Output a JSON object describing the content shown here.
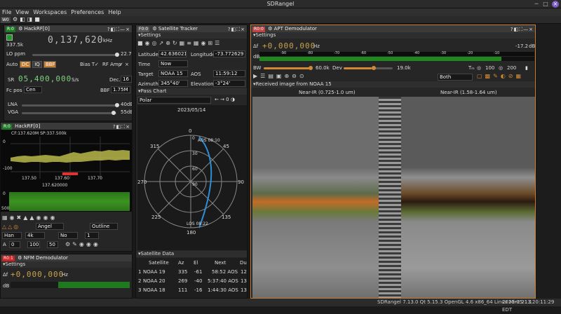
{
  "window": {
    "title": "SDRangel"
  },
  "menu": [
    "File",
    "View",
    "Workspaces",
    "Preferences",
    "Help"
  ],
  "toolbar": {
    "workspace": "W0"
  },
  "hackrf_panel": {
    "badge": "R:0",
    "title": "HackRF[0]",
    "sample_rate": "337.5k",
    "center_freq": "0,137,620",
    "unit": "kHz",
    "lo_ppm_label": "LO ppm",
    "lo_ppm_value": "22.7",
    "auto": "Auto",
    "dc": "DC",
    "iq": "IQ",
    "bbf": "BBF",
    "bias_t": "Bias T",
    "rf_amp": "RF Amp",
    "sr_label": "SR",
    "sr_value": "05,400,000",
    "sr_unit": "S/s",
    "dec_label": "Dec.",
    "dec_value": "16",
    "fcpos_label": "Fc pos",
    "fcpos_value": "Cen",
    "bbf_label": "BBF",
    "bbf_value": "1.75M",
    "lna_label": "LNA",
    "lna_value": "40dB",
    "vga_label": "VGA",
    "vga_value": "55dB"
  },
  "spectrum_panel": {
    "badge": "R:0",
    "title": "HackRF[0]",
    "info": "CF:137.620M SP:337.500k",
    "y_labels": [
      "0",
      "-100"
    ],
    "x_labels": [
      "137.50",
      "137.60",
      "137.70"
    ],
    "center": "137.620000",
    "wf_labels": [
      "0",
      "500"
    ],
    "mode1": "Angel",
    "mode2": "Outline",
    "hann": "Han",
    "fft": "4k",
    "no": "No",
    "one": "1",
    "a_val": "0",
    "avg1": "100",
    "avg2": "50"
  },
  "nfm_panel": {
    "badge": "R0:1",
    "title": "NFM Demodulator",
    "settings": "Settings",
    "freq": "+0,000,000",
    "unit": "Hz",
    "db": "dB"
  },
  "sat_panel": {
    "badge": "F0:0",
    "title": "Satellite Tracker",
    "settings": "Settings",
    "lat_label": "Latitude",
    "lat_value": "42.636021",
    "lon_label": "Longitude",
    "lon_value": "-73.772629",
    "time_label": "Time",
    "time_value": "Now",
    "target_label": "Target",
    "target_value": "NOAA 15",
    "aos_label": "AOS",
    "aos_value": "11:59:12",
    "az_label": "Azimuth",
    "az_value": "345°40'",
    "el_label": "Elevation",
    "el_value": "-3°24'",
    "pass_chart": "Pass Chart",
    "polar": "Polar",
    "date": "2023/05/14",
    "angles": [
      "0",
      "45",
      "90",
      "135",
      "180",
      "225",
      "270",
      "315"
    ],
    "radii": [
      "0",
      "30",
      "60",
      "90"
    ],
    "aos_mark": "AOS 08:10",
    "los_mark": "LOS 08:22",
    "sat_data": "Satellite Data",
    "columns": [
      "Satellite",
      "Az",
      "El",
      "Next",
      "Du"
    ],
    "rows": [
      [
        "1",
        "NOAA 19",
        "335",
        "-61",
        "58:52 AOS",
        "12"
      ],
      [
        "2",
        "NOAA 20",
        "269",
        "-40",
        "5:37:40 AOS",
        "13"
      ],
      [
        "3",
        "NOAA 18",
        "111",
        "-16",
        "1:44:30 AOS",
        "13"
      ]
    ]
  },
  "apt_panel": {
    "badge": "R0:0",
    "title": "APT Demodulator",
    "settings": "Settings",
    "delta": "Δf",
    "freq": "+0,000,000",
    "unit": "Hz",
    "level": "-17.2",
    "level_unit": "dB",
    "db_label": "dB",
    "scale": [
      "-90",
      "-80",
      "-70",
      "-60",
      "-50",
      "-40",
      "-30",
      "-20",
      "-10"
    ],
    "bw_label": "BW",
    "bw_value": "60.0k",
    "dev_label": "Dev",
    "dev_value": "19.0k",
    "tmin_label": "Tₘ",
    "tmin_value": "100",
    "omin_value": "200",
    "channels": "Both",
    "image_section": "Received image from NOAA 15",
    "ch1": "Near-IR (0.725-1.0 um)",
    "ch2": "Near-IR (1.58-1.64 um)"
  },
  "status": {
    "text": "SDRangel 7.13.0 Qt 5.15.3 OpenGL 4.6 x86_64 Linux Mint 21.1",
    "time": "2023-05-13 20:11:29 EDT"
  }
}
